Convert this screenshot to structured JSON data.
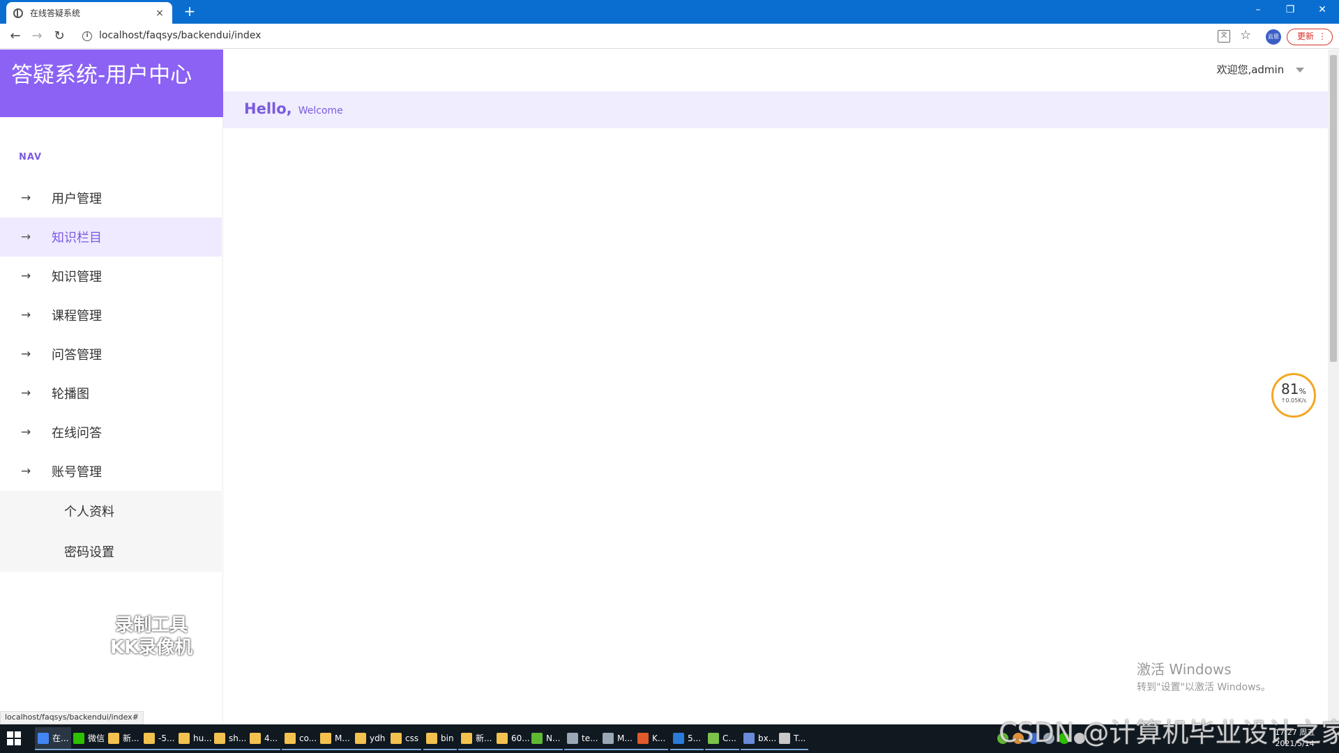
{
  "browser": {
    "tab_title": "在线答疑系统",
    "tab_close": "×",
    "new_tab": "+",
    "url": "localhost/faqsys/backendui/index",
    "profile_label": "云思",
    "update_label": "更新",
    "window_controls": {
      "minimize": "–",
      "restore": "❐",
      "close": "✕"
    }
  },
  "sidebar": {
    "brand": "答疑系统-用户中心",
    "nav_heading": "NAV",
    "items": [
      {
        "label": "用户管理",
        "icon": "arrow-right-icon"
      },
      {
        "label": "知识栏目",
        "icon": "arrow-right-icon",
        "active": true
      },
      {
        "label": "知识管理",
        "icon": "arrow-right-icon"
      },
      {
        "label": "课程管理",
        "icon": "arrow-right-icon"
      },
      {
        "label": "问答管理",
        "icon": "arrow-right-icon"
      },
      {
        "label": "轮播图",
        "icon": "arrow-right-icon"
      },
      {
        "label": "在线问答",
        "icon": "arrow-right-icon"
      },
      {
        "label": "账号管理",
        "icon": "arrow-right-icon"
      }
    ],
    "subitems": [
      {
        "label": "个人资料"
      },
      {
        "label": "密码设置"
      }
    ],
    "accent_color": "#8b62f4"
  },
  "header": {
    "welcome": "欢迎您,admin",
    "hello": "Hello,",
    "hello_sub": "Welcome"
  },
  "overlay": {
    "recorder_watermark_line1": "录制工具",
    "recorder_watermark_line2": "KK录像机",
    "net_percent": "81",
    "net_percent_unit": "%",
    "net_speed": "↑0.05K/s",
    "activate_line1": "激活 Windows",
    "activate_line2": "转到\"设置\"以激活 Windows。",
    "status_url": "localhost/faqsys/backendui/index#",
    "csdn_watermark": "CSDN @计算机毕业设计之家"
  },
  "taskbar": {
    "tasks": [
      {
        "label": "在...",
        "color": "#4285f4",
        "active": true
      },
      {
        "label": "微信",
        "color": "#2dc100"
      },
      {
        "label": "新...",
        "color": "#f2c14e"
      },
      {
        "label": "-5...",
        "color": "#f2c14e"
      },
      {
        "label": "hu...",
        "color": "#f2c14e"
      },
      {
        "label": "sh...",
        "color": "#f2c14e"
      },
      {
        "label": "4...",
        "color": "#f2c14e"
      },
      {
        "label": "co...",
        "color": "#f2c14e"
      },
      {
        "label": "M...",
        "color": "#f2c14e"
      },
      {
        "label": "ydh",
        "color": "#f2c14e"
      },
      {
        "label": "css",
        "color": "#f2c14e"
      },
      {
        "label": "bin",
        "color": "#f2c14e"
      },
      {
        "label": "新...",
        "color": "#f2c14e"
      },
      {
        "label": "60...",
        "color": "#f2c14e"
      },
      {
        "label": "N...",
        "color": "#5fb832"
      },
      {
        "label": "te...",
        "color": "#9aa7b4"
      },
      {
        "label": "M...",
        "color": "#9aa7b4"
      },
      {
        "label": "K...",
        "color": "#e05a2b"
      },
      {
        "label": "5...",
        "color": "#2b7bd8"
      },
      {
        "label": "C...",
        "color": "#7cc24b"
      },
      {
        "label": "bx...",
        "color": "#6a8bd8"
      },
      {
        "label": "T...",
        "color": "#c8c8c8"
      }
    ],
    "time": "17:27 周五",
    "date": "2021/5/14"
  }
}
